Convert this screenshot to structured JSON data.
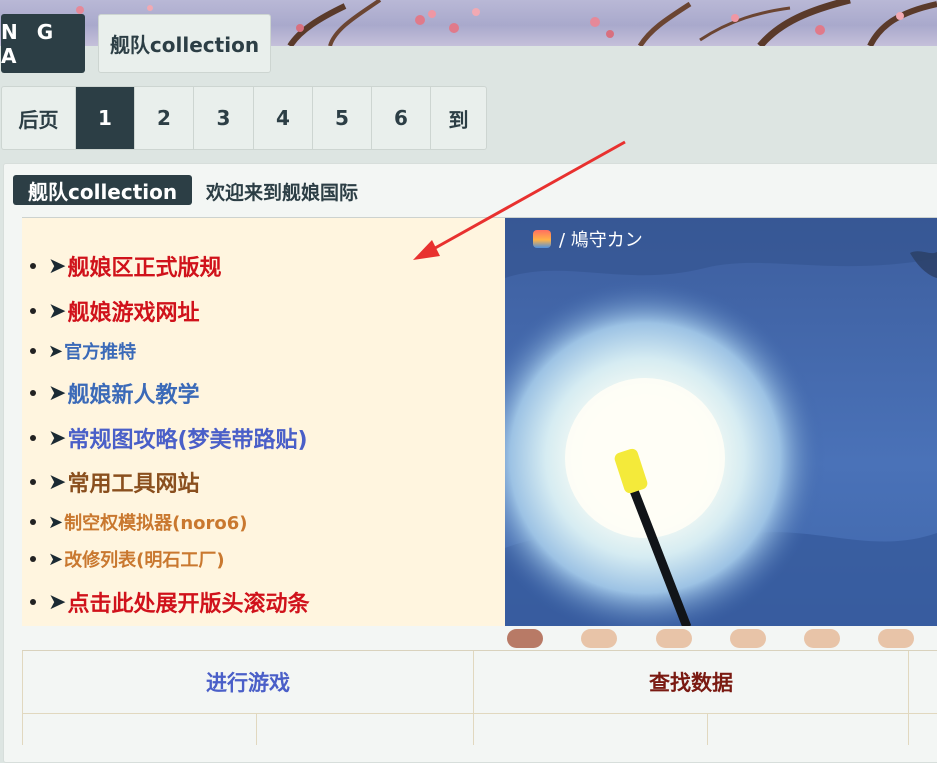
{
  "header": {
    "logo": "N G A",
    "forum_tab": "舰队collection"
  },
  "pager": {
    "items": [
      "后页",
      "1",
      "2",
      "3",
      "4",
      "5",
      "6",
      "到"
    ],
    "active_index": 1
  },
  "forum": {
    "title": "舰队collection",
    "welcome": "欢迎来到舰娘国际"
  },
  "links": {
    "arrow": "➤",
    "items": [
      {
        "label": "舰娘区正式版规",
        "color": "#d0121b"
      },
      {
        "label": "舰娘游戏网址",
        "color": "#d0121b"
      },
      {
        "label": "官方推特",
        "color": "#3b6ab8"
      },
      {
        "label": "舰娘新人教学",
        "color": "#3b6ab8"
      },
      {
        "label": "常规图攻略(梦美带路贴)",
        "color": "#4a5fc8"
      },
      {
        "label": "常用工具网站",
        "color": "#8a4f1e"
      },
      {
        "label": "制空权模拟器(noro6)",
        "color": "#c9782f"
      },
      {
        "label": "改修列表(明石工厂)",
        "color": "#c9782f"
      },
      {
        "label": "点击此处展开版头滚动条",
        "color": "#d0121b"
      }
    ]
  },
  "slideshow": {
    "credit": "/ 鳩守カン",
    "app_icon": "sunrise-app-icon",
    "slide_count": 6,
    "active_slide": 0
  },
  "bottom": {
    "tab_play": "进行游戏",
    "tab_search": "查找数据",
    "tab_play_color": "#4a5fc8",
    "tab_search_color": "#7a1a12"
  }
}
